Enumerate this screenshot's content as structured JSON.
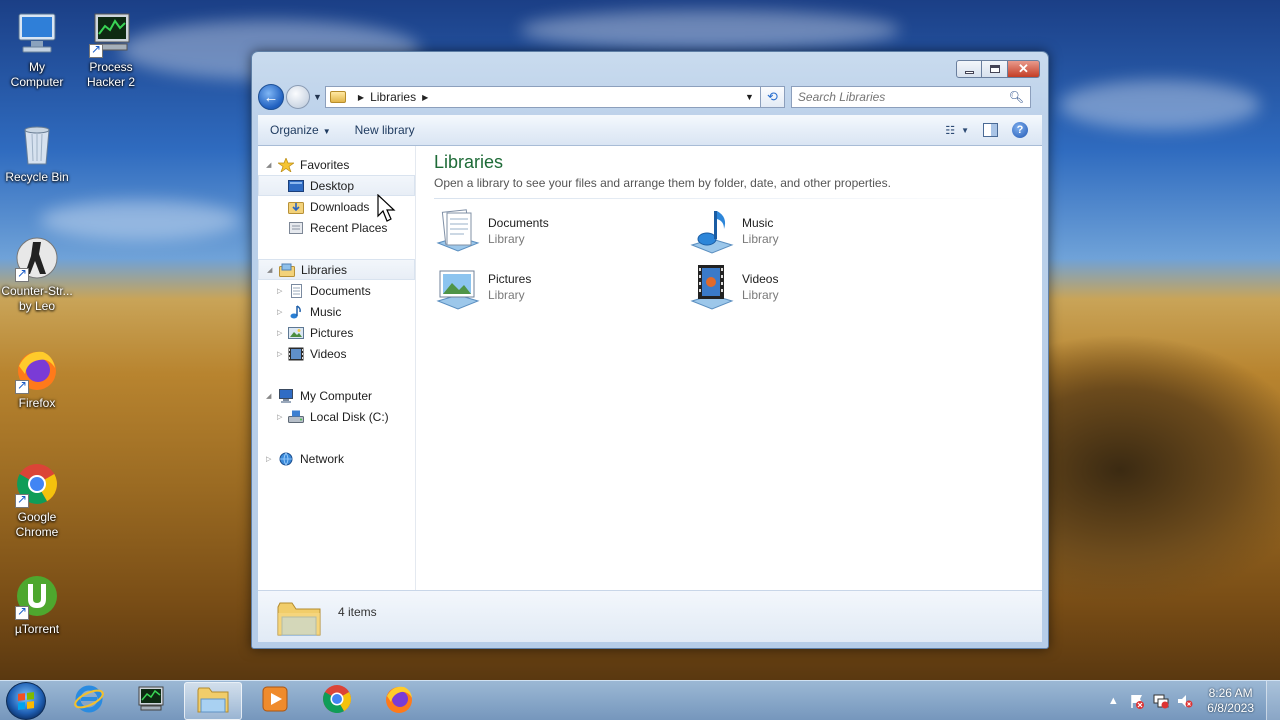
{
  "desktop": {
    "icons": [
      {
        "label": "My\nComputer",
        "icon": "my-computer-icon"
      },
      {
        "label": "Process\nHacker 2",
        "icon": "process-hacker-icon"
      },
      {
        "label": "Recycle Bin",
        "icon": "recycle-bin-icon"
      },
      {
        "label": "Counter-Str...\nby Leo",
        "icon": "counter-strike-icon"
      },
      {
        "label": "Firefox",
        "icon": "firefox-icon"
      },
      {
        "label": "Google\nChrome",
        "icon": "chrome-icon"
      },
      {
        "label": "µTorrent",
        "icon": "utorrent-icon"
      }
    ]
  },
  "window": {
    "address": {
      "crumb": "Libraries"
    },
    "search": {
      "placeholder": "Search Libraries"
    },
    "toolbar": {
      "organize": "Organize",
      "new_library": "New library"
    },
    "nav": {
      "favorites": "Favorites",
      "desktop": "Desktop",
      "downloads": "Downloads",
      "recent_places": "Recent Places",
      "libraries": "Libraries",
      "documents": "Documents",
      "music": "Music",
      "pictures": "Pictures",
      "videos": "Videos",
      "my_computer": "My Computer",
      "local_disk": "Local Disk (C:)",
      "network": "Network"
    },
    "main": {
      "title": "Libraries",
      "subtitle": "Open a library to see your files and arrange them by folder, date, and other properties.",
      "libraries": [
        {
          "name": "Documents",
          "type": "Library"
        },
        {
          "name": "Music",
          "type": "Library"
        },
        {
          "name": "Pictures",
          "type": "Library"
        },
        {
          "name": "Videos",
          "type": "Library"
        }
      ]
    },
    "details": {
      "count": "4 items"
    }
  },
  "taskbar": {
    "time": "8:26 AM",
    "date": "6/8/2023",
    "pinned": [
      "internet-explorer-icon",
      "process-hacker-icon",
      "file-explorer-icon",
      "media-player-icon",
      "chrome-icon",
      "firefox-icon"
    ]
  },
  "colors": {
    "title_green": "#1e6b37",
    "selection": "#e8eef6",
    "accent": "#1f5fbf"
  }
}
